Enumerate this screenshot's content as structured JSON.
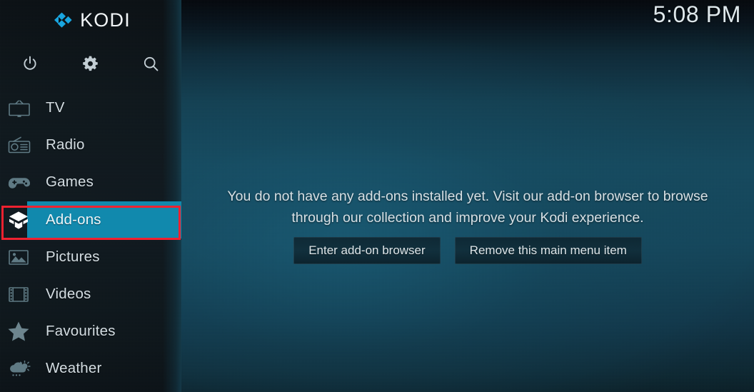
{
  "app": {
    "name": "Kodi",
    "brand_text": "KODI",
    "brand_mark_icon": "kodi-logo-icon",
    "accent_color": "#1189ad",
    "annotation_color": "#f02230",
    "sidebar_bg_color": "#0b1419",
    "text_color": "#d6e0e5"
  },
  "header": {
    "clock": "5:08 PM"
  },
  "sidebar": {
    "top_actions": [
      {
        "name": "power",
        "icon": "power-icon",
        "label": "Power"
      },
      {
        "name": "settings",
        "icon": "gear-icon",
        "label": "Settings"
      },
      {
        "name": "search",
        "icon": "search-icon",
        "label": "Search"
      }
    ],
    "items": [
      {
        "label": "TV",
        "icon": "tv-icon",
        "selected": false
      },
      {
        "label": "Radio",
        "icon": "radio-icon",
        "selected": false
      },
      {
        "label": "Games",
        "icon": "gamepad-icon",
        "selected": false
      },
      {
        "label": "Add-ons",
        "icon": "addons-box-icon",
        "selected": true
      },
      {
        "label": "Pictures",
        "icon": "pictures-icon",
        "selected": false
      },
      {
        "label": "Videos",
        "icon": "videos-icon",
        "selected": false
      },
      {
        "label": "Favourites",
        "icon": "star-icon",
        "selected": false
      },
      {
        "label": "Weather",
        "icon": "weather-icon",
        "selected": false
      }
    ]
  },
  "main": {
    "message": "You do not have any add-ons installed yet. Visit our add-on browser to browse through our collection and improve your Kodi experience.",
    "buttons": [
      {
        "label": "Enter add-on browser"
      },
      {
        "label": "Remove this main menu item"
      }
    ]
  }
}
